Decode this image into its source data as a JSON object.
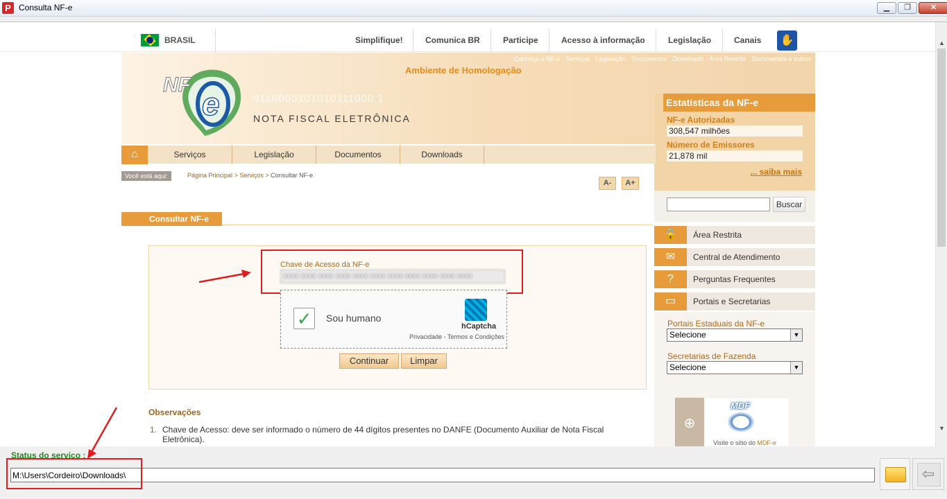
{
  "window": {
    "title": "Consulta NF-e",
    "icon": "P",
    "min": "▁",
    "restore": "❐",
    "close": "✕"
  },
  "gov_bar": {
    "country": "BRASIL",
    "links": [
      "Simplifique!",
      "Comunica BR",
      "Participe",
      "Acesso à informação",
      "Legislação",
      "Canais"
    ]
  },
  "banner": {
    "top_links": [
      "Conheça a NF-e",
      "Serviços",
      "Legislação",
      "Documentos",
      "Downloads",
      "Área Restrita",
      "Documentos e outros"
    ],
    "ambiente": "Ambiente de Homologação",
    "logo_text": "NF",
    "logo_e": "e",
    "system_name": "NOTA FISCAL ELETRÔNICA",
    "binary": "0110000101010111000 1"
  },
  "stats": {
    "title": "Estatísticas da NF-e",
    "autorizadas_label": "NF-e Autorizadas",
    "autorizadas_value": "308,547 milhões",
    "emissores_label": "Número de Emissores",
    "emissores_value": "21,878 mil",
    "saiba_mais": "... saiba mais"
  },
  "main_nav": {
    "items": [
      "Serviços",
      "Legislação",
      "Documentos",
      "Downloads"
    ]
  },
  "breadcrumb": {
    "label": "Você está aqui:",
    "links": [
      "Página Principal",
      "Serviços"
    ],
    "separator": ">",
    "current": "Consultar NF-e"
  },
  "font_buttons": {
    "decrease": "A-",
    "increase": "A+"
  },
  "page": {
    "title": "Consultar NF-e"
  },
  "form": {
    "chave_label": "Chave de Acesso da NF-e",
    "chave_value": "0000 0000 0000 0000 0000 0000 0000 0000 0000 0000 0000",
    "captcha_text": "Sou humano",
    "captcha_brand": "hCaptcha",
    "captcha_links": "Privacidade - Termos e Condições",
    "continuar": "Continuar",
    "limpar": "Limpar"
  },
  "observacoes": {
    "title": "Observações",
    "items": [
      {
        "num": "1.",
        "text": "Chave de Acesso: deve ser informado o número de 44 dígitos presentes no DANFE (Documento Auxiliar de Nota Fiscal Eletrônica)."
      }
    ]
  },
  "sidebar": {
    "search_button": "Buscar",
    "rows": [
      "Área Restrita",
      "Central de Atendimento",
      "Perguntas Frequentes",
      "Portais e Secretarias"
    ],
    "portais_label": "Portais Estaduais da NF-e",
    "portais_value": "Selecione",
    "secretarias_label": "Secretarias de Fazenda",
    "secretarias_value": "Selecione",
    "mdfe_logo": "MDF",
    "mdfe_text_prefix": "Visite o sítio do",
    "mdfe_text_link": "MDF-e"
  },
  "bottom": {
    "status_label": "Status do servico :",
    "path": "M:\\Users\\Cordeiro\\Downloads\\"
  },
  "colors": {
    "accent": "#e89b3a",
    "highlight": "#e21c1c",
    "status": "#1d8c1d"
  }
}
